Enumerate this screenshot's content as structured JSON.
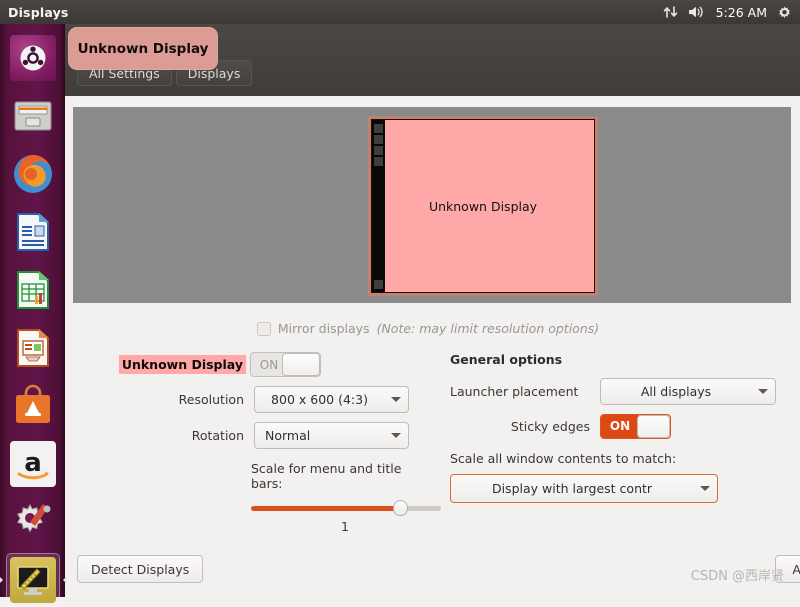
{
  "panel": {
    "title": "Displays",
    "clock": "5:26 AM",
    "icons": [
      "network-transfer-icon",
      "volume-icon",
      "gear-icon"
    ]
  },
  "launcher": {
    "items": [
      {
        "name": "ubuntu-dash",
        "label": "Ubuntu Dash"
      },
      {
        "name": "files",
        "label": "Files"
      },
      {
        "name": "firefox",
        "label": "Firefox"
      },
      {
        "name": "libreoffice-writer",
        "label": "LibreOffice Writer"
      },
      {
        "name": "libreoffice-calc",
        "label": "LibreOffice Calc"
      },
      {
        "name": "libreoffice-impress",
        "label": "LibreOffice Impress"
      },
      {
        "name": "ubuntu-software",
        "label": "Ubuntu Software"
      },
      {
        "name": "amazon",
        "label": "Amazon"
      },
      {
        "name": "system-settings",
        "label": "System Settings"
      },
      {
        "name": "displays",
        "label": "Displays",
        "active": true
      }
    ]
  },
  "window": {
    "title": "Displays",
    "controls": {
      "close": "×",
      "minimize": "−",
      "maximize": "□"
    },
    "toolbar": {
      "all_settings": "All Settings",
      "displays": "Displays"
    },
    "tooltip": "Unknown Display"
  },
  "preview": {
    "monitor_label": "Unknown Display"
  },
  "mirror": {
    "label": "Mirror displays",
    "note": "(Note: may limit resolution options)",
    "checked": false
  },
  "display_settings": {
    "name": "Unknown Display",
    "power_toggle": "ON",
    "resolution_label": "Resolution",
    "resolution_value": "800 x 600 (4:3)",
    "rotation_label": "Rotation",
    "rotation_value": "Normal",
    "scale_label": "Scale for menu and title bars:",
    "scale_value": "1"
  },
  "general_options": {
    "title": "General options",
    "launcher_placement_label": "Launcher placement",
    "launcher_placement_value": "All displays",
    "sticky_edges_label": "Sticky edges",
    "sticky_edges_value": "ON",
    "scale_all_label": "Scale all window contents to match:",
    "scale_all_value": "Display with largest contr"
  },
  "actions": {
    "detect": "Detect Displays",
    "apply": "Apply"
  },
  "watermark": "CSDN @西岸贤",
  "colors": {
    "accent_orange": "#dd4814",
    "display_pink": "#ffa8a8",
    "launcher_purple": "#61154a",
    "panel_dark": "#3c3835"
  }
}
